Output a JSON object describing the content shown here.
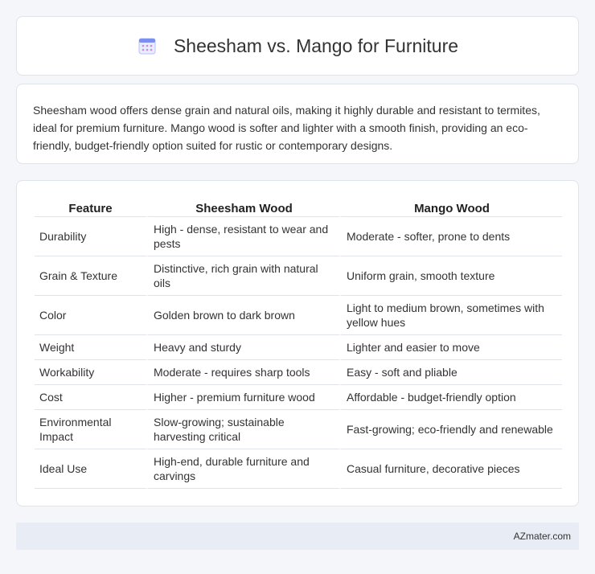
{
  "header": {
    "title": "Sheesham vs. Mango for Furniture",
    "icon": "calendar-icon"
  },
  "intro": {
    "text": "Sheesham wood offers dense grain and natural oils, making it highly durable and resistant to termites, ideal for premium furniture. Mango wood is softer and lighter with a smooth finish, providing an eco-friendly, budget-friendly option suited for rustic or contemporary designs."
  },
  "table": {
    "headers": [
      "Feature",
      "Sheesham Wood",
      "Mango Wood"
    ],
    "rows": [
      [
        "Durability",
        "High - dense, resistant to wear and pests",
        "Moderate - softer, prone to dents"
      ],
      [
        "Grain & Texture",
        "Distinctive, rich grain with natural oils",
        "Uniform grain, smooth texture"
      ],
      [
        "Color",
        "Golden brown to dark brown",
        "Light to medium brown, sometimes with yellow hues"
      ],
      [
        "Weight",
        "Heavy and sturdy",
        "Lighter and easier to move"
      ],
      [
        "Workability",
        "Moderate - requires sharp tools",
        "Easy - soft and pliable"
      ],
      [
        "Cost",
        "Higher - premium furniture wood",
        "Affordable - budget-friendly option"
      ],
      [
        "Environmental Impact",
        "Slow-growing; sustainable harvesting critical",
        "Fast-growing; eco-friendly and renewable"
      ],
      [
        "Ideal Use",
        "High-end, durable furniture and carvings",
        "Casual furniture, decorative pieces"
      ]
    ]
  },
  "footer": {
    "brand": "AZmater.com"
  },
  "colors": {
    "background": "#f4f6f9",
    "card": "#ffffff",
    "footer": "#e8edf5",
    "icon_accent": "#7b8ff0"
  }
}
